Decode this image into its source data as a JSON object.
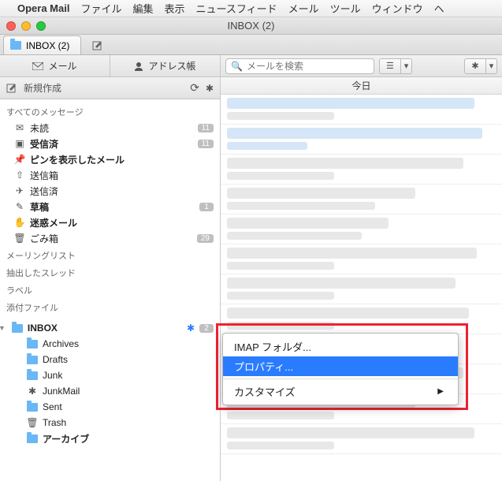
{
  "menubar": {
    "apple": "",
    "app": "Opera Mail",
    "items": [
      "ファイル",
      "編集",
      "表示",
      "ニュースフィード",
      "メール",
      "ツール",
      "ウィンドウ",
      "ヘ"
    ]
  },
  "window": {
    "title": "INBOX (2)"
  },
  "tabs": {
    "active": "INBOX (2)"
  },
  "sidebar": {
    "mail_btn": "メール",
    "addr_btn": "アドレス帳",
    "compose": "新規作成",
    "sections": {
      "all": "すべてのメッセージ",
      "items1": [
        {
          "icon": "envelope",
          "label": "未読",
          "badge": "11"
        },
        {
          "icon": "inbox",
          "label": "受信済",
          "bold": true,
          "badge": "11"
        },
        {
          "icon": "pin",
          "label": "ピンを表示したメール",
          "bold": true
        },
        {
          "icon": "outbox",
          "label": "送信箱"
        },
        {
          "icon": "sent",
          "label": "送信済"
        },
        {
          "icon": "pencil",
          "label": "草稿",
          "bold": true,
          "badge": "1"
        },
        {
          "icon": "hand",
          "label": "迷惑メール",
          "bold": true
        },
        {
          "icon": "trash",
          "label": "ごみ箱",
          "badge": "29"
        }
      ],
      "labels": [
        "メーリングリスト",
        "抽出したスレッド",
        "ラベル",
        "添付ファイル"
      ],
      "account": {
        "name": "INBOX",
        "badge": "2",
        "subs": [
          {
            "icon": "folder",
            "label": "Archives"
          },
          {
            "icon": "folder",
            "label": "Drafts"
          },
          {
            "icon": "folder",
            "label": "Junk"
          },
          {
            "icon": "gear",
            "label": "JunkMail"
          },
          {
            "icon": "folder",
            "label": "Sent"
          },
          {
            "icon": "trash",
            "label": "Trash"
          },
          {
            "icon": "folder",
            "label": "アーカイブ",
            "bold": true
          }
        ]
      }
    }
  },
  "toolbar": {
    "search_placeholder": "メールを検索"
  },
  "datehdr": "今日",
  "contextmenu": {
    "items": [
      {
        "label": "IMAP フォルダ..."
      },
      {
        "label": "プロパティ...",
        "selected": true
      },
      {
        "sep": true
      },
      {
        "label": "カスタマイズ",
        "submenu": true
      }
    ]
  }
}
